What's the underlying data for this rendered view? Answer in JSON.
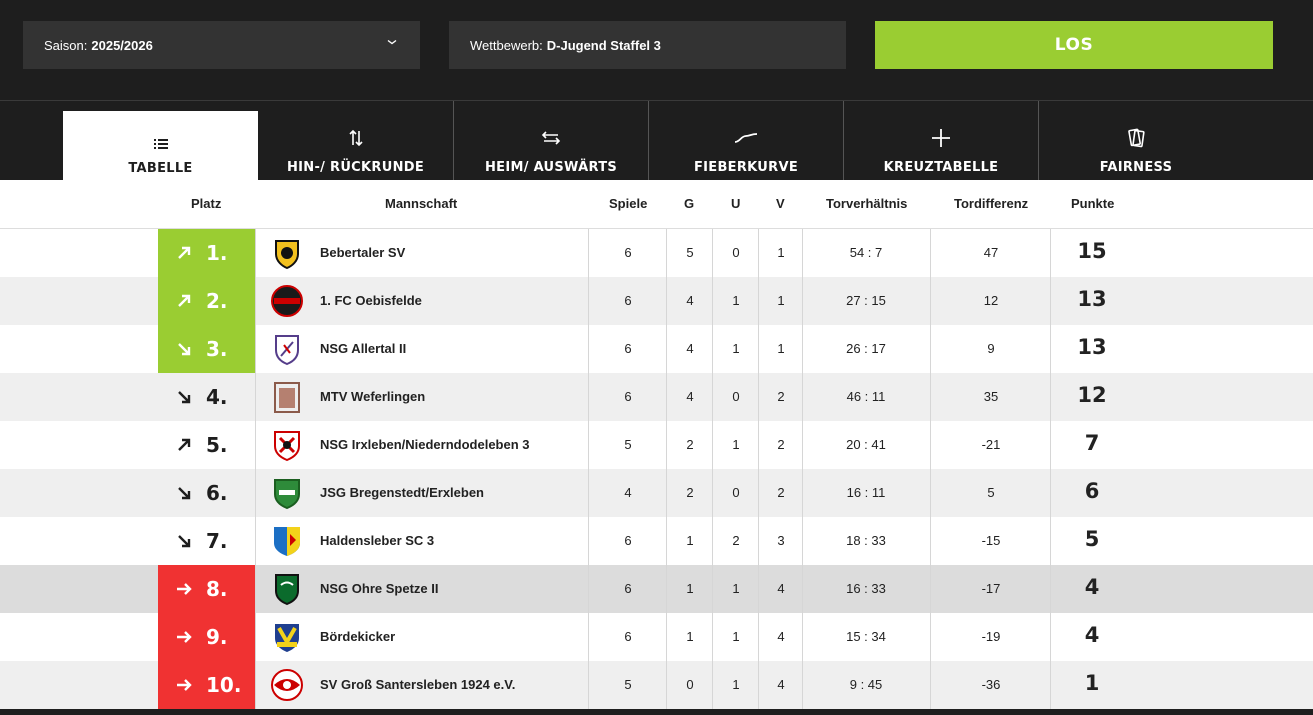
{
  "filters": {
    "saison_label": "Saison:",
    "saison_value": "2025/2026",
    "wettbewerb_label": "Wettbewerb:",
    "wettbewerb_value": "D-Jugend Staffel 3",
    "submit_label": "LOS"
  },
  "tabs": [
    {
      "label": "TABELLE",
      "icon": "list-icon",
      "active": true
    },
    {
      "label": "HIN-/ RÜCKRUNDE",
      "icon": "up-down-arrows-icon"
    },
    {
      "label": "HEIM/ AUSWÄRTS",
      "icon": "left-right-arrows-icon"
    },
    {
      "label": "FIEBERKURVE",
      "icon": "curve-icon"
    },
    {
      "label": "KREUZTABELLE",
      "icon": "plus-icon"
    },
    {
      "label": "FAIRNESS",
      "icon": "cards-icon"
    }
  ],
  "columns": {
    "platz": "Platz",
    "mannschaft": "Mannschaft",
    "spiele": "Spiele",
    "g": "G",
    "u": "U",
    "v": "V",
    "torverhaeltnis": "Torverhältnis",
    "tordifferenz": "Tordifferenz",
    "punkte": "Punkte"
  },
  "colors": {
    "dark": "#1e1e1e",
    "accent_green": "#9acd32",
    "accent_red": "#f03232"
  },
  "rows": [
    {
      "pos": "1.",
      "trend": "up",
      "zone": "up",
      "team": "Bebertaler SV",
      "spiele": "6",
      "g": "5",
      "u": "0",
      "v": "1",
      "tore": "54 : 7",
      "diff": "47",
      "punkte": "15"
    },
    {
      "pos": "2.",
      "trend": "up",
      "zone": "up",
      "team": "1. FC Oebisfelde",
      "spiele": "6",
      "g": "4",
      "u": "1",
      "v": "1",
      "tore": "27 : 15",
      "diff": "12",
      "punkte": "13"
    },
    {
      "pos": "3.",
      "trend": "down",
      "zone": "up",
      "team": "NSG Allertal II",
      "spiele": "6",
      "g": "4",
      "u": "1",
      "v": "1",
      "tore": "26 : 17",
      "diff": "9",
      "punkte": "13"
    },
    {
      "pos": "4.",
      "trend": "down",
      "zone": "none",
      "team": "MTV Weferlingen",
      "spiele": "6",
      "g": "4",
      "u": "0",
      "v": "2",
      "tore": "46 : 11",
      "diff": "35",
      "punkte": "12"
    },
    {
      "pos": "5.",
      "trend": "up",
      "zone": "none",
      "team": "NSG Irxleben/Niederndodeleben 3",
      "spiele": "5",
      "g": "2",
      "u": "1",
      "v": "2",
      "tore": "20 : 41",
      "diff": "-21",
      "punkte": "7"
    },
    {
      "pos": "6.",
      "trend": "down",
      "zone": "none",
      "team": "JSG Bregenstedt/Erxleben",
      "spiele": "4",
      "g": "2",
      "u": "0",
      "v": "2",
      "tore": "16 : 11",
      "diff": "5",
      "punkte": "6"
    },
    {
      "pos": "7.",
      "trend": "down",
      "zone": "none",
      "team": "Haldensleber SC 3",
      "spiele": "6",
      "g": "1",
      "u": "2",
      "v": "3",
      "tore": "18 : 33",
      "diff": "-15",
      "punkte": "5"
    },
    {
      "pos": "8.",
      "trend": "same",
      "zone": "down",
      "highlight": true,
      "team": "NSG Ohre Spetze II",
      "spiele": "6",
      "g": "1",
      "u": "1",
      "v": "4",
      "tore": "16 : 33",
      "diff": "-17",
      "punkte": "4"
    },
    {
      "pos": "9.",
      "trend": "same",
      "zone": "down",
      "team": "Bördekicker",
      "spiele": "6",
      "g": "1",
      "u": "1",
      "v": "4",
      "tore": "15 : 34",
      "diff": "-19",
      "punkte": "4"
    },
    {
      "pos": "10.",
      "trend": "same",
      "zone": "down",
      "team": "SV Groß Santersleben 1924 e.V.",
      "spiele": "5",
      "g": "0",
      "u": "1",
      "v": "4",
      "tore": "9 : 45",
      "diff": "-36",
      "punkte": "1"
    }
  ]
}
